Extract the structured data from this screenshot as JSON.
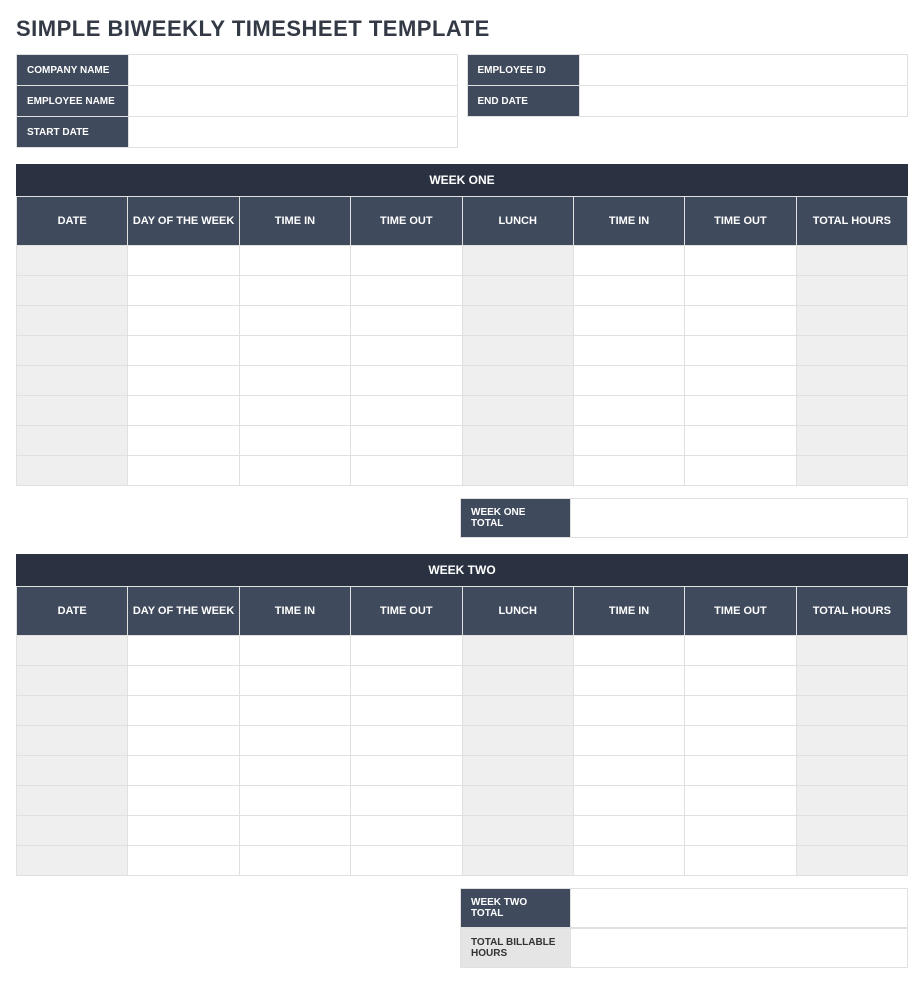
{
  "title": "SIMPLE BIWEEKLY TIMESHEET TEMPLATE",
  "header": {
    "company_name_label": "COMPANY NAME",
    "company_name_value": "",
    "employee_id_label": "EMPLOYEE ID",
    "employee_id_value": "",
    "employee_name_label": "EMPLOYEE NAME",
    "employee_name_value": "",
    "end_date_label": "END DATE",
    "end_date_value": "",
    "start_date_label": "START DATE",
    "start_date_value": ""
  },
  "columns": {
    "date": "DATE",
    "day": "DAY OF THE WEEK",
    "time_in1": "TIME IN",
    "time_out1": "TIME OUT",
    "lunch": "LUNCH",
    "time_in2": "TIME IN",
    "time_out2": "TIME OUT",
    "total_hours": "TOTAL HOURS"
  },
  "week1": {
    "title": "WEEK ONE",
    "total_label": "WEEK ONE TOTAL",
    "total_value": "",
    "rows": [
      {
        "date": "",
        "day": "",
        "time_in1": "",
        "time_out1": "",
        "lunch": "",
        "time_in2": "",
        "time_out2": "",
        "total": ""
      },
      {
        "date": "",
        "day": "",
        "time_in1": "",
        "time_out1": "",
        "lunch": "",
        "time_in2": "",
        "time_out2": "",
        "total": ""
      },
      {
        "date": "",
        "day": "",
        "time_in1": "",
        "time_out1": "",
        "lunch": "",
        "time_in2": "",
        "time_out2": "",
        "total": ""
      },
      {
        "date": "",
        "day": "",
        "time_in1": "",
        "time_out1": "",
        "lunch": "",
        "time_in2": "",
        "time_out2": "",
        "total": ""
      },
      {
        "date": "",
        "day": "",
        "time_in1": "",
        "time_out1": "",
        "lunch": "",
        "time_in2": "",
        "time_out2": "",
        "total": ""
      },
      {
        "date": "",
        "day": "",
        "time_in1": "",
        "time_out1": "",
        "lunch": "",
        "time_in2": "",
        "time_out2": "",
        "total": ""
      },
      {
        "date": "",
        "day": "",
        "time_in1": "",
        "time_out1": "",
        "lunch": "",
        "time_in2": "",
        "time_out2": "",
        "total": ""
      },
      {
        "date": "",
        "day": "",
        "time_in1": "",
        "time_out1": "",
        "lunch": "",
        "time_in2": "",
        "time_out2": "",
        "total": ""
      }
    ]
  },
  "week2": {
    "title": "WEEK TWO",
    "total_label": "WEEK TWO TOTAL",
    "total_value": "",
    "rows": [
      {
        "date": "",
        "day": "",
        "time_in1": "",
        "time_out1": "",
        "lunch": "",
        "time_in2": "",
        "time_out2": "",
        "total": ""
      },
      {
        "date": "",
        "day": "",
        "time_in1": "",
        "time_out1": "",
        "lunch": "",
        "time_in2": "",
        "time_out2": "",
        "total": ""
      },
      {
        "date": "",
        "day": "",
        "time_in1": "",
        "time_out1": "",
        "lunch": "",
        "time_in2": "",
        "time_out2": "",
        "total": ""
      },
      {
        "date": "",
        "day": "",
        "time_in1": "",
        "time_out1": "",
        "lunch": "",
        "time_in2": "",
        "time_out2": "",
        "total": ""
      },
      {
        "date": "",
        "day": "",
        "time_in1": "",
        "time_out1": "",
        "lunch": "",
        "time_in2": "",
        "time_out2": "",
        "total": ""
      },
      {
        "date": "",
        "day": "",
        "time_in1": "",
        "time_out1": "",
        "lunch": "",
        "time_in2": "",
        "time_out2": "",
        "total": ""
      },
      {
        "date": "",
        "day": "",
        "time_in1": "",
        "time_out1": "",
        "lunch": "",
        "time_in2": "",
        "time_out2": "",
        "total": ""
      },
      {
        "date": "",
        "day": "",
        "time_in1": "",
        "time_out1": "",
        "lunch": "",
        "time_in2": "",
        "time_out2": "",
        "total": ""
      }
    ]
  },
  "billable": {
    "label": "TOTAL BILLABLE HOURS",
    "value": ""
  }
}
